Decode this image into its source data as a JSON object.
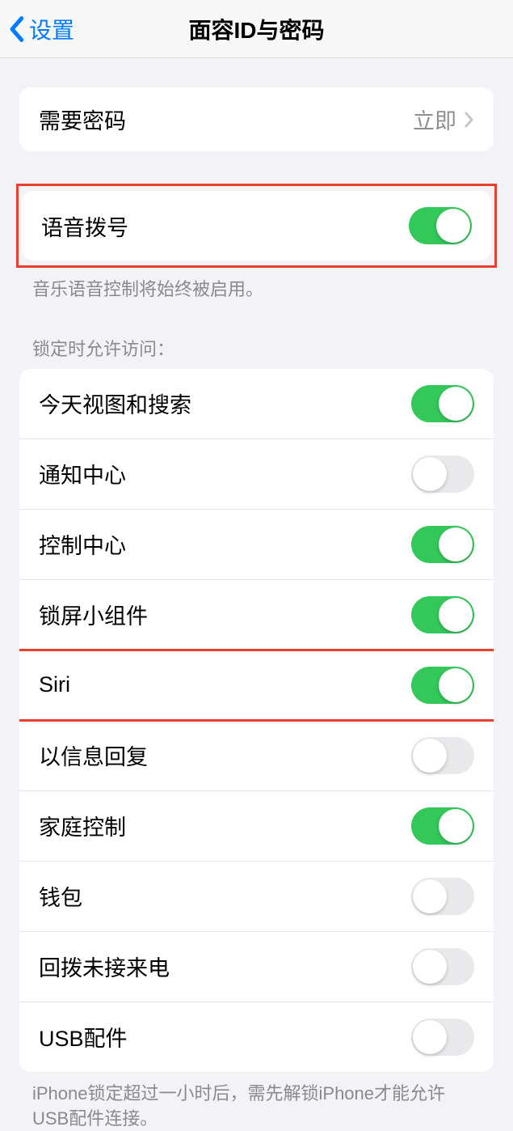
{
  "navbar": {
    "back_label": "设置",
    "title": "面容ID与密码"
  },
  "require_passcode": {
    "label": "需要密码",
    "value": "立即"
  },
  "voice_dial": {
    "label": "语音拨号",
    "footer": "音乐语音控制将始终被启用。",
    "on": true
  },
  "lock_access": {
    "header": "锁定时允许访问：",
    "items": [
      {
        "label": "今天视图和搜索",
        "on": true
      },
      {
        "label": "通知中心",
        "on": false
      },
      {
        "label": "控制中心",
        "on": true
      },
      {
        "label": "锁屏小组件",
        "on": true
      },
      {
        "label": "Siri",
        "on": true
      },
      {
        "label": "以信息回复",
        "on": false
      },
      {
        "label": "家庭控制",
        "on": true
      },
      {
        "label": "钱包",
        "on": false
      },
      {
        "label": "回拨未接来电",
        "on": false
      },
      {
        "label": "USB配件",
        "on": false
      }
    ],
    "footer": "iPhone锁定超过一小时后，需先解锁iPhone才能允许USB配件连接。"
  }
}
